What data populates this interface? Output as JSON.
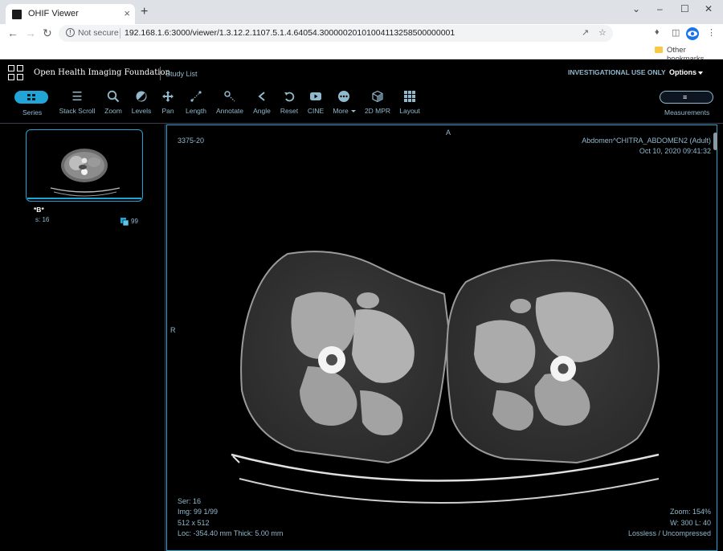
{
  "browser": {
    "tab_title": "OHIF Viewer",
    "tab_close": "×",
    "new_tab": "+",
    "window_controls": [
      "⌄",
      "–",
      "☐",
      "✕"
    ],
    "security_label": "Not secure",
    "url": "192.168.1.6:3000/viewer/1.3.12.2.1107.5.1.4.64054.30000020101004113258500000001",
    "bookmark": "Other bookmarks"
  },
  "header": {
    "brand": "Open Health Imaging Foundation",
    "study_list": "Study List",
    "investigational": "INVESTIGATIONAL USE ONLY",
    "options": "Options"
  },
  "toolbar": {
    "series": "Series",
    "tools": [
      {
        "label": "Stack Scroll",
        "icon": "bars-icon"
      },
      {
        "label": "Zoom",
        "icon": "search-icon"
      },
      {
        "label": "Levels",
        "icon": "contrast-icon"
      },
      {
        "label": "Pan",
        "icon": "arrows-icon"
      },
      {
        "label": "Length",
        "icon": "ruler-icon"
      },
      {
        "label": "Annotate",
        "icon": "pin-icon"
      },
      {
        "label": "Angle",
        "icon": "angle-icon"
      },
      {
        "label": "Reset",
        "icon": "reset-icon"
      },
      {
        "label": "CINE",
        "icon": "play-icon"
      },
      {
        "label": "More",
        "icon": "more-icon"
      },
      {
        "label": "2D MPR",
        "icon": "cube-icon"
      },
      {
        "label": "Layout",
        "icon": "grid-icon"
      }
    ],
    "measurements": "Measurements"
  },
  "study_browser": {
    "description": "*B*",
    "series": "s: 16",
    "instance_count": "99"
  },
  "viewport": {
    "orientation_top": "A",
    "orientation_left": "R",
    "top_left": "3375-20",
    "patient": "Abdomen^CHITRA_ABDOMEN2 (Adult)",
    "study_date": "Oct 10, 2020 09:41:32",
    "series": "Ser: 16",
    "image": "Img: 99 1/99",
    "dimensions": "512 x 512",
    "location": "Loc: -354.40 mm Thick: 5.00 mm",
    "zoom": "Zoom: 154%",
    "window": "W: 300 L: 40",
    "compression": "Lossless / Uncompressed"
  }
}
